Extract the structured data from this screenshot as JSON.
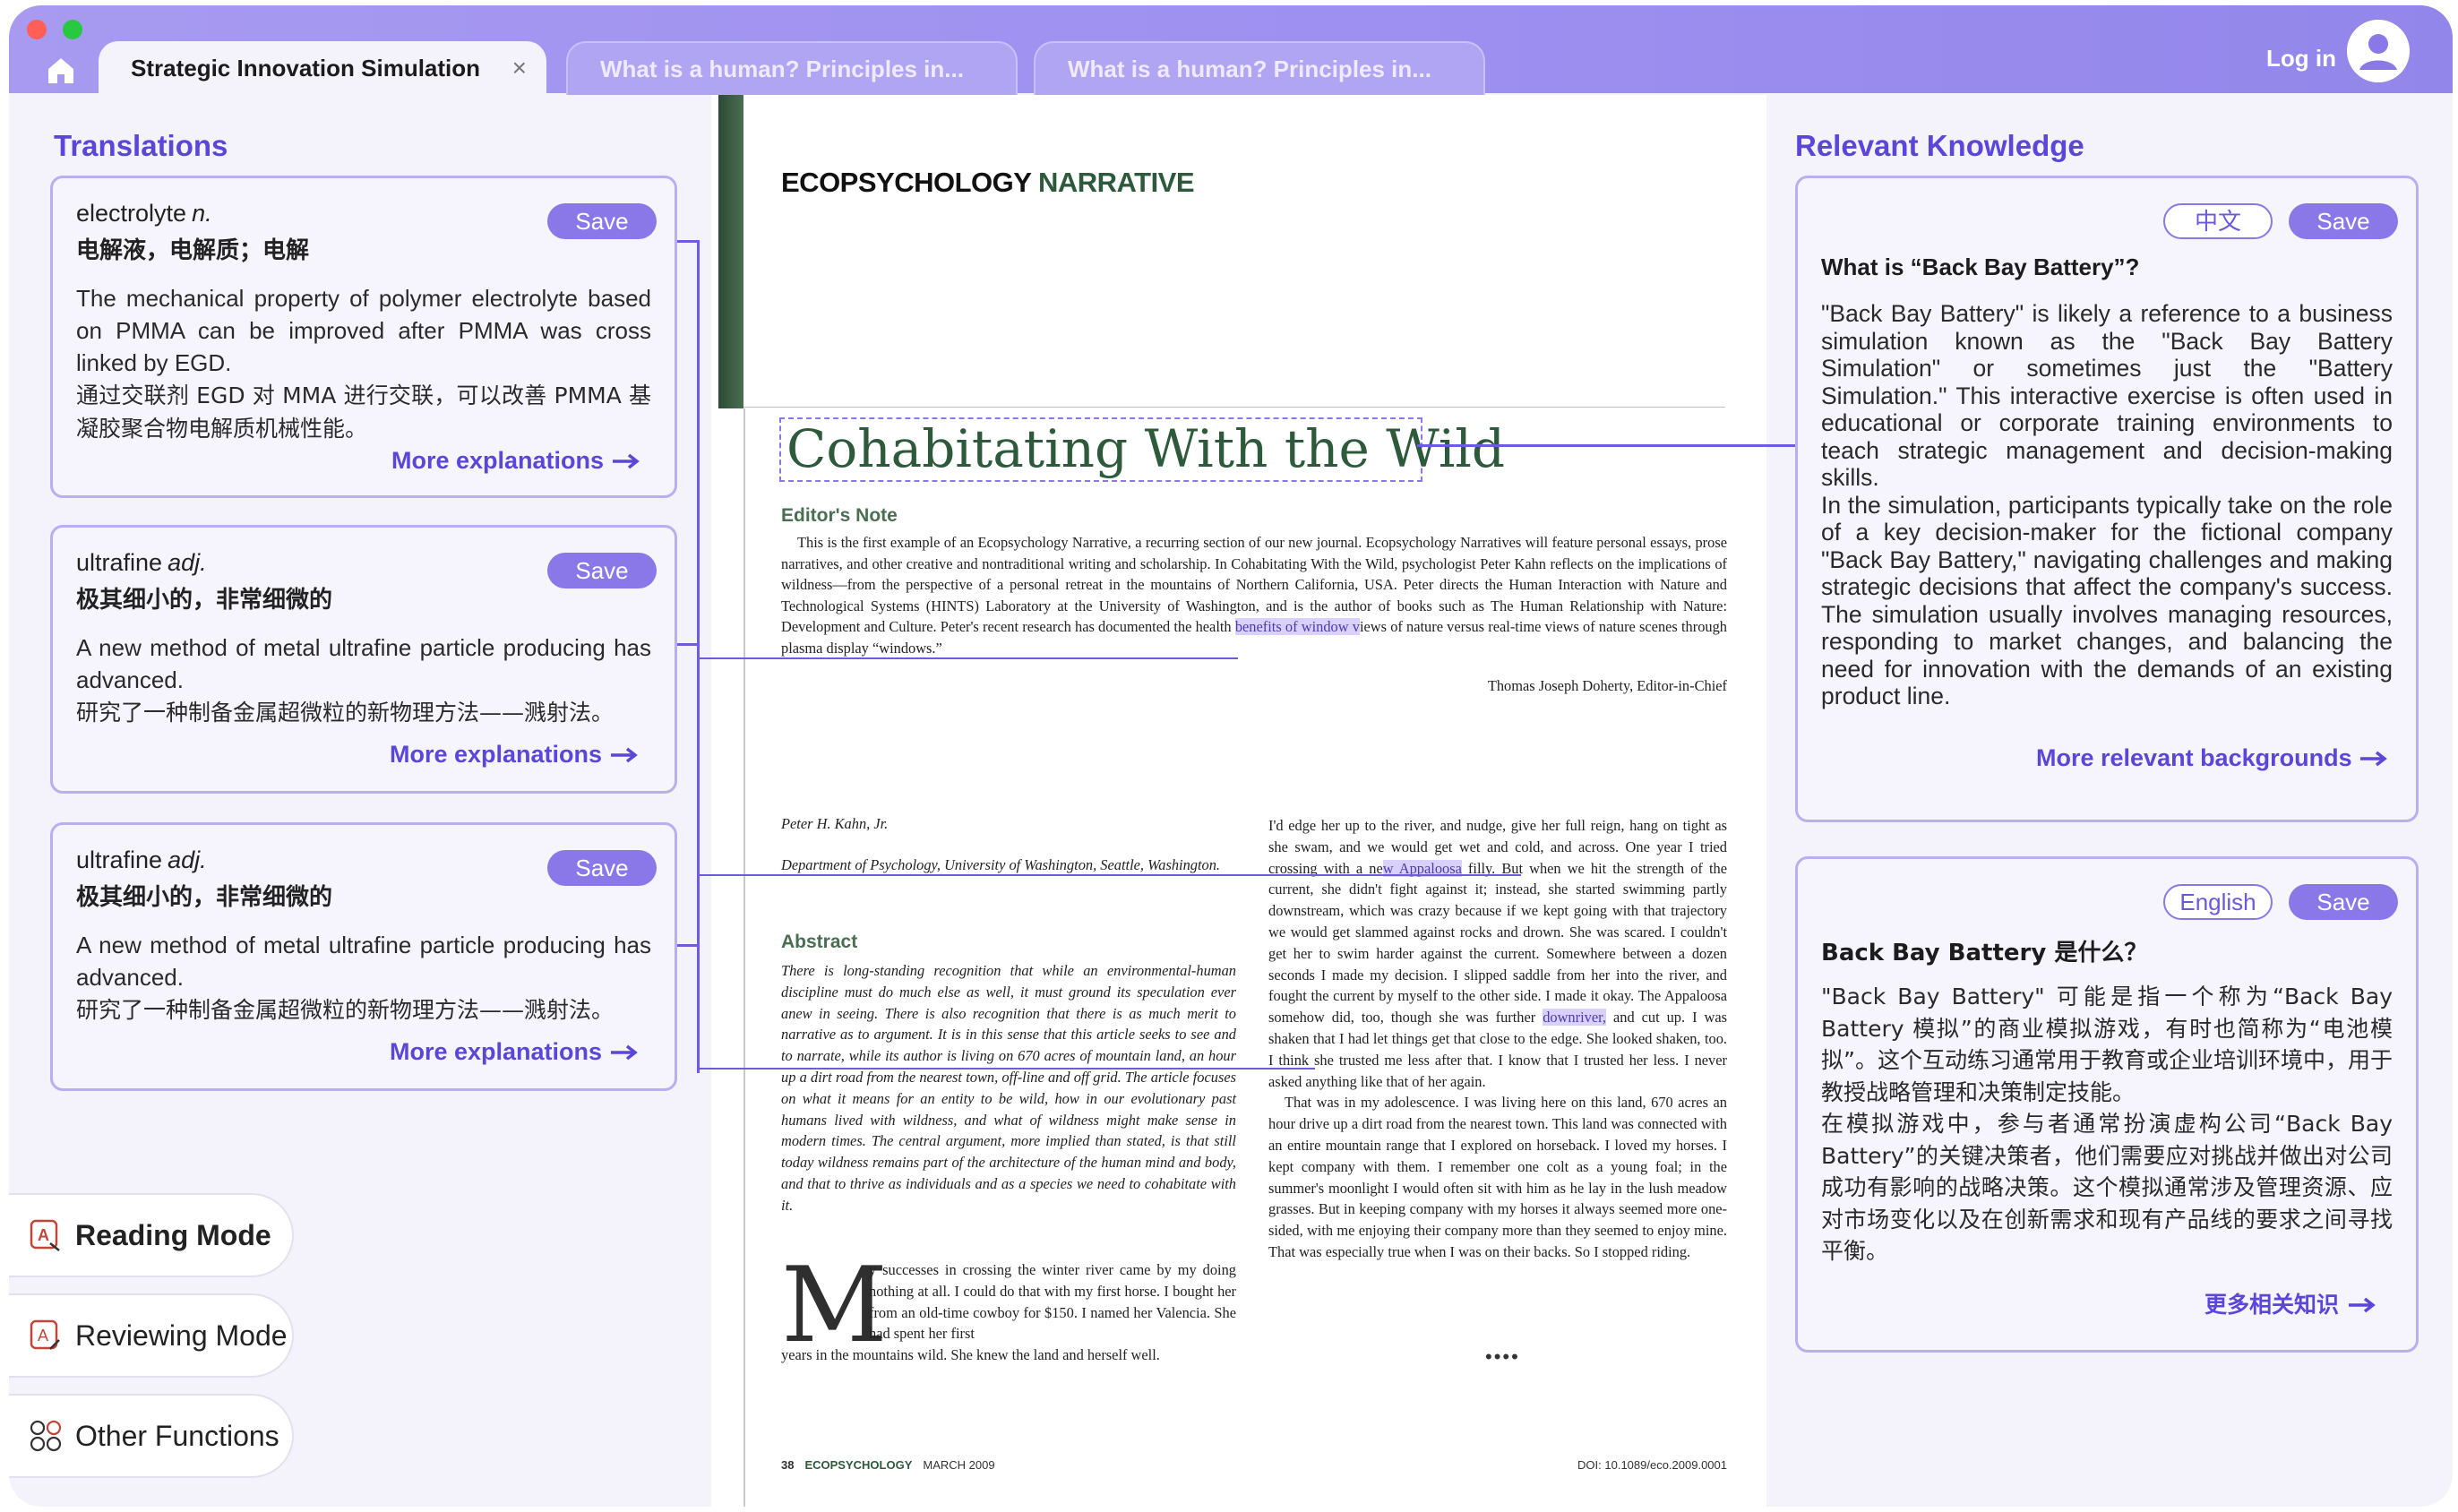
{
  "tabs": [
    {
      "label": "Strategic Innovation Simulation",
      "active": true
    },
    {
      "label": "What is a human? Principles in...",
      "active": false
    },
    {
      "label": "What is a human? Principles in...",
      "active": false
    }
  ],
  "header": {
    "login": "Log in"
  },
  "translations": {
    "title": "Translations",
    "cards": [
      {
        "word": "electrolyte",
        "pos": "n.",
        "cn": "电解液，电解质；电解",
        "save": "Save",
        "en": "The mechanical property of polymer electrolyte based on PMMA can be improved after PMMA was cross linked by EGD.",
        "zh": "通过交联剂 EGD 对 MMA 进行交联，可以改善 PMMA 基凝胶聚合物电解质机械性能。",
        "more": "More explanations"
      },
      {
        "word": "ultrafine",
        "pos": "adj.",
        "cn": "极其细小的，非常细微的",
        "save": "Save",
        "en": "A new method of metal ultrafine particle producing has advanced.",
        "zh": "研究了一种制备金属超微粒的新物理方法——溅射法。",
        "more": "More explanations"
      },
      {
        "word": "ultrafine",
        "pos": "adj.",
        "cn": "极其细小的，非常细微的",
        "save": "Save",
        "en": "A new method of metal ultrafine particle producing has advanced.",
        "zh": "研究了一种制备金属超微粒的新物理方法——溅射法。",
        "more": "More explanations"
      }
    ]
  },
  "modes": {
    "reading": "Reading Mode",
    "reviewing": "Reviewing Mode",
    "other": "Other Functions"
  },
  "document": {
    "journal_a": "ECOPSYCHOLOGY",
    "journal_b": "NARRATIVE",
    "title": "Cohabitating With the Wild",
    "editor_head": "Editor's Note",
    "editor_note_a": "This is the first example of an Ecopsychology Narrative, a recurring section of our new journal. Ecopsychology Narratives will feature personal essays, prose narratives, and other creative and nontraditional writing and scholarship. In Cohabitating With the Wild, psychologist Peter Kahn reflects on the implications of wildness—from the perspective of a personal retreat in the mountains of Northern California, USA. Peter directs the Human Interaction with Nature and Technological Systems (HINTS) Laboratory at the University of Washington, and is the author of books such as The Human Relationship with Nature: Development and Culture. Peter's recent research has documented the health ",
    "editor_note_hl": "benefits of window v",
    "editor_note_b": "iews of nature versus real-time views of nature scenes through plasma display “windows.”",
    "editor_sign": "Thomas Joseph Doherty, Editor-in-Chief",
    "author": "Peter H. Kahn, Jr.",
    "affiliation": "Department of Psychology, University of Washington, Seattle, Washington.",
    "abstract_head": "Abstract",
    "abstract": "There is long-standing recognition that while an environmental-human discipline must do much else as well, it must ground its speculation ever anew in seeing. There is also recognition that there is as much merit to narrative as to argument. It is in this sense that this article seeks to see and to narrate, while its author is living on 670 acres of mountain land, an hour up a dirt road from the nearest town, off-line and off grid. The article focuses on what it means for an entity to be wild, how in our evolutionary past humans lived with wildness, and what of wildness might make sense in modern times. The central argument, more implied than stated, is that still today wildness remains part of the architecture of the human mind and body, and that to thrive as individuals and as a species we need to cohabitate with it.",
    "dropcap": "M",
    "body_left_a": "y successes in crossing the winter river came by my doing nothing at all. I could do that with my first horse. I bought her from an old-time cowboy for $150. I named her Valencia. She had spent her first",
    "body_left_b": "years in the mountains wild. She knew the land and herself well.",
    "body_right_1a": "I'd edge her up to the river, and nudge, give her full reign, hang on tight as she swam, and we would get wet and cold, and across. One year I tried crossing with a ne",
    "body_right_1hl": "w Appaloosa",
    "body_right_1b": " filly. But when we hit the strength of the current, she didn't fight against it; instead, she started swimming partly downstream, which was crazy because if we kept going with that trajectory we would get slammed against rocks and drown. She was scared. I couldn't get her to swim harder against the current. Somewhere between a dozen seconds I made my decision. I slipped saddle from her into the river, and fought the current by myself to the other side. I made it okay. The Appaloosa somehow did, too, though she was further ",
    "body_right_1hl2": "downriver,",
    "body_right_1c": " and cut up. I was shaken that I had let things get that close to the edge. She looked shaken, too. I think she trusted me less after that. I know that I trusted her less. I never asked anything like that of her again.",
    "body_right_2": "That was in my adolescence. I was living here on this land, 670 acres an hour drive up a dirt road from the nearest town. This land was connected with an entire mountain range that I explored on horseback. I loved my horses. I kept company with them. I remember one colt as a young foal; in the summer's moonlight I would often sit with him as he lay in the lush meadow grasses. But in keeping company with my horses it always seemed more one-sided, with me enjoying their company more than they seemed to enjoy mine. That was especially true when I was on their backs. So I stopped riding.",
    "dots": "••••",
    "footer_page": "38",
    "footer_journal": "ECOPSYCHOLOGY",
    "footer_date": "MARCH 2009",
    "footer_doi": "DOI: 10.1089/eco.2009.0001"
  },
  "knowledge": {
    "title": "Relevant Knowledge",
    "cards": [
      {
        "lang_btn": "中文",
        "save": "Save",
        "title": "What is “Back Bay Battery”?",
        "p1": "\"Back Bay Battery\" is likely a reference to a business simulation known as the \"Back Bay Battery Simulation\" or sometimes just the \"Battery Simulation.\" This interactive exercise is often used in educational or corporate training environments to teach strategic management and decision-making skills.",
        "p2": "In the simulation, participants typically take on the role of a key decision-maker for the fictional company \"Back Bay Battery,\" navigating challenges and making strategic decisions that affect the company's success. The simulation usually involves managing resources, responding to market changes, and balancing the need for innovation with the demands of an existing product line.",
        "more": "More relevant backgrounds"
      },
      {
        "lang_btn": "English",
        "save": "Save",
        "title": "Back Bay Battery 是什么？",
        "p1": "\"Back Bay Battery\" 可能是指一个称为“Back Bay Battery 模拟”的商业模拟游戏，有时也简称为“电池模拟”。这个互动练习通常用于教育或企业培训环境中，用于教授战略管理和决策制定技能。",
        "p2": "在模拟游戏中，参与者通常扮演虚构公司“Back Bay Battery”的关键决策者，他们需要应对挑战并做出对公司成功有影响的战略决策。这个模拟通常涉及管理资源、应对市场变化以及在创新需求和现有产品线的要求之间寻找平衡。",
        "more": "更多相关知识"
      }
    ]
  },
  "colors": {
    "accent": "#8b78e8",
    "title_bar": "#9d8ff0",
    "link": "#5a46d8",
    "journal_green": "#2e5a3c",
    "highlight": "#d9d1fb"
  },
  "icons": [
    "home-icon",
    "close-icon",
    "user-avatar-icon",
    "arrow-right-icon",
    "reading-mode-icon",
    "reviewing-mode-icon",
    "other-functions-icon"
  ]
}
